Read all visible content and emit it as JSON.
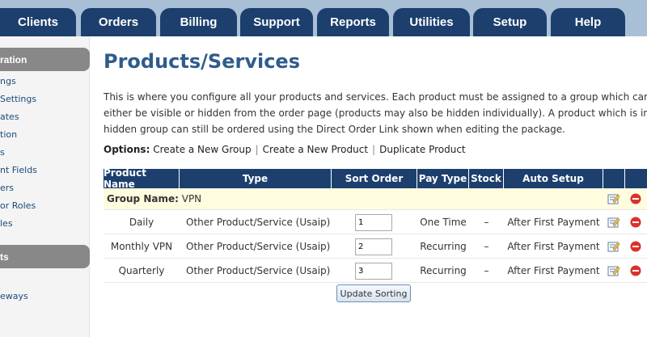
{
  "nav": {
    "tabs": [
      "Clients",
      "Orders",
      "Billing",
      "Support",
      "Reports",
      "Utilities",
      "Setup",
      "Help"
    ]
  },
  "sidebar": {
    "section1_title": "ration",
    "section1_items": [
      "ngs",
      "Settings",
      "ates",
      "tion",
      "s",
      "nt Fields",
      "ers",
      "or Roles",
      "les"
    ],
    "section2_title": "ts",
    "section2_items": [
      "eways"
    ]
  },
  "page": {
    "title": "Products/Services",
    "description_lines": [
      "This is where you configure all your products and services. Each product must be assigned to a group which can",
      "either be visible or hidden from the order page (products may also be hidden individually). A product which is in a",
      "hidden group can still be ordered using the Direct Order Link shown when editing the package."
    ],
    "options_label": "Options:",
    "option_links": [
      "Create a New Group",
      "Create a New Product",
      "Duplicate Product"
    ]
  },
  "table": {
    "headers": [
      "Product Name",
      "Type",
      "Sort Order",
      "Pay Type",
      "Stock",
      "Auto Setup"
    ],
    "group_label": "Group Name:",
    "group_name": "VPN",
    "rows": [
      {
        "name": "Daily",
        "type": "Other Product/Service (Usaip)",
        "sort": "1",
        "pay": "One Time",
        "stock": "–",
        "setup": "After First Payment"
      },
      {
        "name": "Monthly VPN",
        "type": "Other Product/Service (Usaip)",
        "sort": "2",
        "pay": "Recurring",
        "stock": "–",
        "setup": "After First Payment"
      },
      {
        "name": "Quarterly",
        "type": "Other Product/Service (Usaip)",
        "sort": "3",
        "pay": "Recurring",
        "stock": "–",
        "setup": "After First Payment"
      }
    ],
    "update_button": "Update Sorting"
  },
  "icons": {
    "edit": "edit-icon",
    "delete": "delete-icon"
  },
  "colors": {
    "nav_tab": "#1c3f6e",
    "nav_bar": "#a9bfd6",
    "title": "#2f5c8a",
    "group_row": "#fffce0",
    "delete": "#d9322b"
  }
}
